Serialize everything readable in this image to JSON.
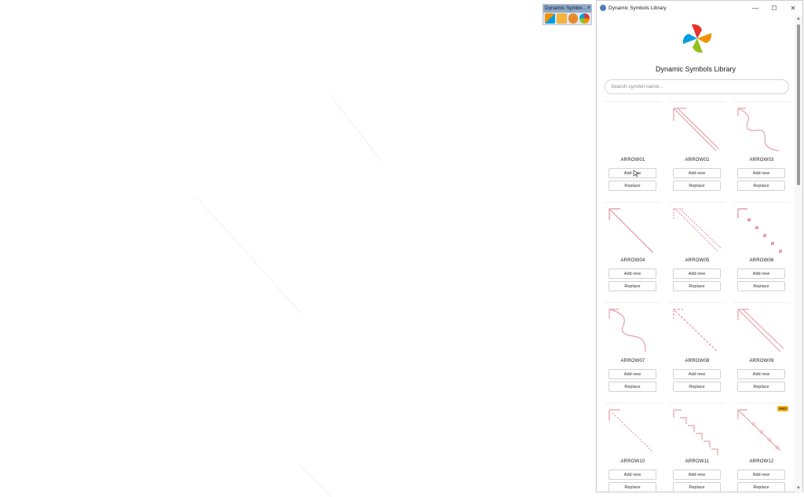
{
  "mini_toolbar": {
    "title": "Dynamic Symbo...",
    "close": "×"
  },
  "window": {
    "title": "Dynamic Symbols Library",
    "minimize": "—",
    "maximize": "☐",
    "close": "✕"
  },
  "app": {
    "title": "Dynamic Symbols Library",
    "search_placeholder": "Search symbol name..."
  },
  "symbols": [
    {
      "name": "ARROW01",
      "add": "Add new",
      "replace": "Replace"
    },
    {
      "name": "ARROW02",
      "add": "Add new",
      "replace": "Replace"
    },
    {
      "name": "ARROW03",
      "add": "Add new",
      "replace": "Replace"
    },
    {
      "name": "ARROW04",
      "add": "Add new",
      "replace": "Replace"
    },
    {
      "name": "ARROW05",
      "add": "Add new",
      "replace": "Replace"
    },
    {
      "name": "ARROW06",
      "add": "Add new",
      "replace": "Replace"
    },
    {
      "name": "ARROW07",
      "add": "Add new",
      "replace": "Replace"
    },
    {
      "name": "ARROW08",
      "add": "Add new",
      "replace": "Replace"
    },
    {
      "name": "ARROW09",
      "add": "Add new",
      "replace": "Replace"
    },
    {
      "name": "ARROW10",
      "add": "Add new",
      "replace": "Replace"
    },
    {
      "name": "ARROW11",
      "add": "Add new",
      "replace": "Replace"
    },
    {
      "name": "ARROW12",
      "add": "Add new",
      "replace": "Replace",
      "badge": "PRO"
    }
  ],
  "colors": {
    "arrow": "#e7a1aa",
    "pro_badge": "#f2b21a",
    "logo": [
      "#e6332a",
      "#f39200",
      "#95c11f",
      "#009fe3"
    ]
  }
}
